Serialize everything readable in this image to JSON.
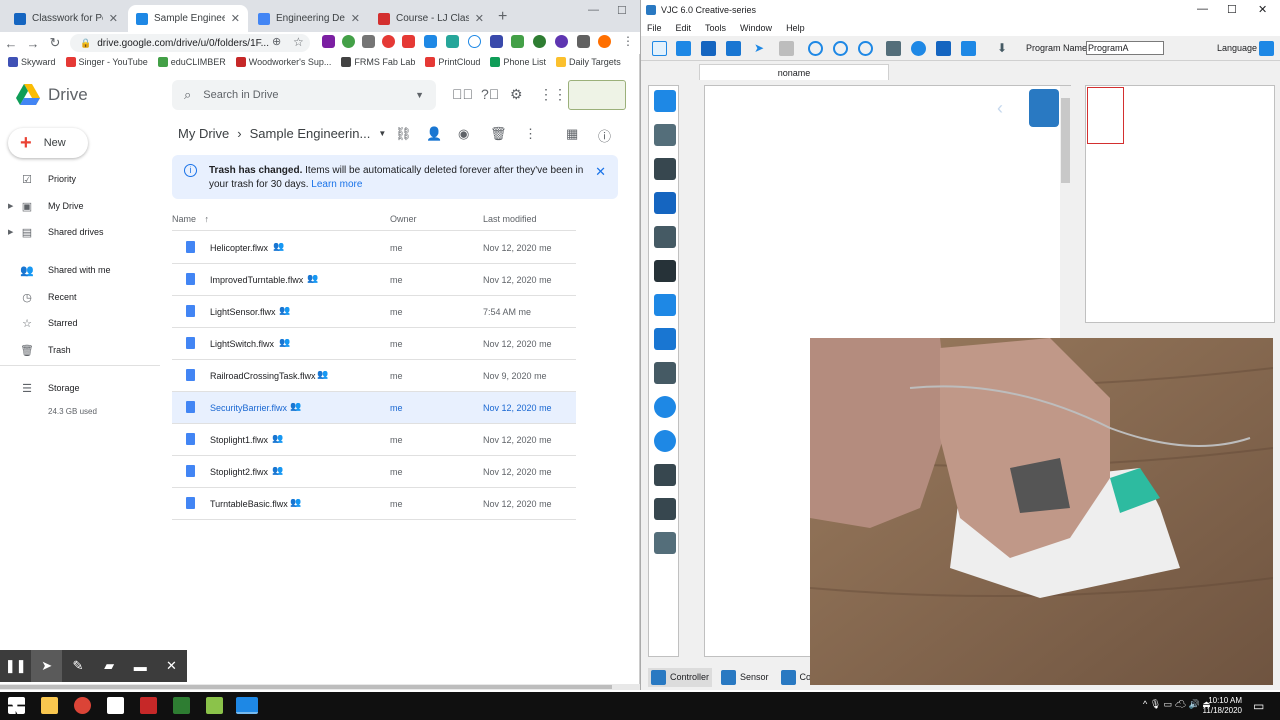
{
  "browser": {
    "tabs": [
      {
        "label": "Classwork for Perfetto",
        "icon_color": "#1565c0"
      },
      {
        "label": "Sample Engineering D",
        "icon_color": "#1e88e5"
      },
      {
        "label": "Engineering Design Lo",
        "icon_color": "#4285f4"
      },
      {
        "label": "Course - LJ ClassAct II",
        "icon_color": "#d32f2f"
      }
    ],
    "url": "drive.google.com/drive/u/0/folders/1F...",
    "bookmarks": [
      {
        "label": "Skyward",
        "color": "#3f51b5"
      },
      {
        "label": "Singer - YouTube",
        "color": "#e53935"
      },
      {
        "label": "eduCLIMBER",
        "color": "#43a047"
      },
      {
        "label": "Woodworker's Sup...",
        "color": "#c62828"
      },
      {
        "label": "FRMS Fab Lab",
        "color": "#424242"
      },
      {
        "label": "PrintCloud",
        "color": "#e53935"
      },
      {
        "label": "Phone List",
        "color": "#0f9d58"
      },
      {
        "label": "Daily Targets",
        "color": "#fbc02d"
      }
    ]
  },
  "drive": {
    "app_name": "Drive",
    "search_placeholder": "Search in Drive",
    "new_label": "New",
    "nav": [
      {
        "label": "Priority",
        "icon": "priority-icon"
      },
      {
        "label": "My Drive",
        "icon": "my-drive-icon"
      },
      {
        "label": "Shared drives",
        "icon": "shared-drives-icon"
      },
      {
        "label": "Shared with me",
        "icon": "shared-with-me-icon"
      },
      {
        "label": "Recent",
        "icon": "recent-icon"
      },
      {
        "label": "Starred",
        "icon": "star-icon"
      },
      {
        "label": "Trash",
        "icon": "trash-icon"
      },
      {
        "label": "Storage",
        "icon": "storage-icon"
      }
    ],
    "storage_used": "24.3 GB used",
    "breadcrumb": {
      "root": "My Drive",
      "current": "Sample Engineerin..."
    },
    "banner": {
      "title": "Trash has changed.",
      "text": "Items will be automatically deleted forever after they've been in your trash for 30 days.",
      "link": "Learn more"
    },
    "columns": {
      "name": "Name",
      "owner": "Owner",
      "modified": "Last modified"
    },
    "files": [
      {
        "name": "Helicopter.flwx",
        "owner": "me",
        "modified": "Nov 12, 2020",
        "by": "me"
      },
      {
        "name": "ImprovedTurntable.flwx",
        "owner": "me",
        "modified": "Nov 12, 2020",
        "by": "me"
      },
      {
        "name": "LightSensor.flwx",
        "owner": "me",
        "modified": "7:54 AM",
        "by": "me"
      },
      {
        "name": "LightSwitch.flwx",
        "owner": "me",
        "modified": "Nov 12, 2020",
        "by": "me"
      },
      {
        "name": "RailroadCrossingTask.flwx",
        "owner": "me",
        "modified": "Nov 9, 2020",
        "by": "me"
      },
      {
        "name": "SecurityBarrier.flwx",
        "owner": "me",
        "modified": "Nov 12, 2020",
        "by": "me",
        "selected": true
      },
      {
        "name": "Stoplight1.flwx",
        "owner": "me",
        "modified": "Nov 12, 2020",
        "by": "me"
      },
      {
        "name": "Stoplight2.flwx",
        "owner": "me",
        "modified": "Nov 12, 2020",
        "by": "me"
      },
      {
        "name": "TurntableBasic.flwx",
        "owner": "me",
        "modified": "Nov 12, 2020",
        "by": "me"
      }
    ]
  },
  "vjc": {
    "title": "VJC 6.0 Creative-series",
    "menu": [
      "File",
      "Edit",
      "Tools",
      "Window",
      "Help"
    ],
    "program_name_label": "Program Name:",
    "program_name_value": "ProgramA",
    "language_label": "Language",
    "doc_tab": "noname",
    "bottom_tabs": [
      "Controller",
      "Sensor",
      "Comma"
    ],
    "palette_colors": [
      "#1e88e5",
      "#546e7a",
      "#37474f",
      "#1565c0",
      "#455a64",
      "#263238",
      "#1e88e5",
      "#1976d2",
      "#455a64",
      "#1e88e5",
      "#1e88e5",
      "#37474f",
      "#37474f",
      "#546e7a"
    ]
  },
  "taskbar": {
    "time": "10:10 AM",
    "date": "11/18/2020"
  }
}
